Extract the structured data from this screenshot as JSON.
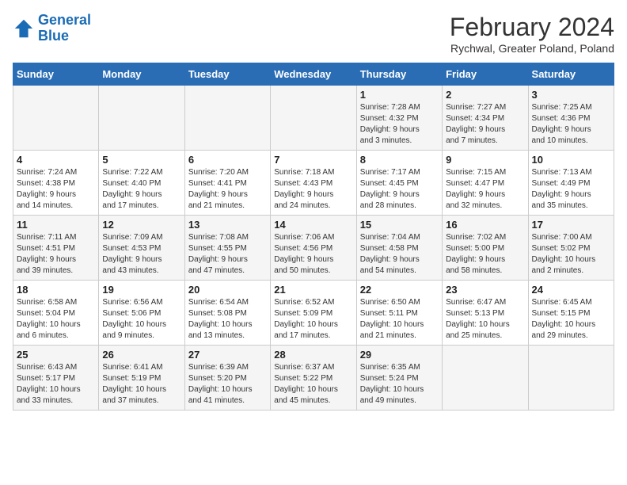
{
  "logo": {
    "line1": "General",
    "line2": "Blue"
  },
  "header": {
    "month": "February 2024",
    "location": "Rychwal, Greater Poland, Poland"
  },
  "weekdays": [
    "Sunday",
    "Monday",
    "Tuesday",
    "Wednesday",
    "Thursday",
    "Friday",
    "Saturday"
  ],
  "weeks": [
    [
      {
        "day": "",
        "info": ""
      },
      {
        "day": "",
        "info": ""
      },
      {
        "day": "",
        "info": ""
      },
      {
        "day": "",
        "info": ""
      },
      {
        "day": "1",
        "info": "Sunrise: 7:28 AM\nSunset: 4:32 PM\nDaylight: 9 hours\nand 3 minutes."
      },
      {
        "day": "2",
        "info": "Sunrise: 7:27 AM\nSunset: 4:34 PM\nDaylight: 9 hours\nand 7 minutes."
      },
      {
        "day": "3",
        "info": "Sunrise: 7:25 AM\nSunset: 4:36 PM\nDaylight: 9 hours\nand 10 minutes."
      }
    ],
    [
      {
        "day": "4",
        "info": "Sunrise: 7:24 AM\nSunset: 4:38 PM\nDaylight: 9 hours\nand 14 minutes."
      },
      {
        "day": "5",
        "info": "Sunrise: 7:22 AM\nSunset: 4:40 PM\nDaylight: 9 hours\nand 17 minutes."
      },
      {
        "day": "6",
        "info": "Sunrise: 7:20 AM\nSunset: 4:41 PM\nDaylight: 9 hours\nand 21 minutes."
      },
      {
        "day": "7",
        "info": "Sunrise: 7:18 AM\nSunset: 4:43 PM\nDaylight: 9 hours\nand 24 minutes."
      },
      {
        "day": "8",
        "info": "Sunrise: 7:17 AM\nSunset: 4:45 PM\nDaylight: 9 hours\nand 28 minutes."
      },
      {
        "day": "9",
        "info": "Sunrise: 7:15 AM\nSunset: 4:47 PM\nDaylight: 9 hours\nand 32 minutes."
      },
      {
        "day": "10",
        "info": "Sunrise: 7:13 AM\nSunset: 4:49 PM\nDaylight: 9 hours\nand 35 minutes."
      }
    ],
    [
      {
        "day": "11",
        "info": "Sunrise: 7:11 AM\nSunset: 4:51 PM\nDaylight: 9 hours\nand 39 minutes."
      },
      {
        "day": "12",
        "info": "Sunrise: 7:09 AM\nSunset: 4:53 PM\nDaylight: 9 hours\nand 43 minutes."
      },
      {
        "day": "13",
        "info": "Sunrise: 7:08 AM\nSunset: 4:55 PM\nDaylight: 9 hours\nand 47 minutes."
      },
      {
        "day": "14",
        "info": "Sunrise: 7:06 AM\nSunset: 4:56 PM\nDaylight: 9 hours\nand 50 minutes."
      },
      {
        "day": "15",
        "info": "Sunrise: 7:04 AM\nSunset: 4:58 PM\nDaylight: 9 hours\nand 54 minutes."
      },
      {
        "day": "16",
        "info": "Sunrise: 7:02 AM\nSunset: 5:00 PM\nDaylight: 9 hours\nand 58 minutes."
      },
      {
        "day": "17",
        "info": "Sunrise: 7:00 AM\nSunset: 5:02 PM\nDaylight: 10 hours\nand 2 minutes."
      }
    ],
    [
      {
        "day": "18",
        "info": "Sunrise: 6:58 AM\nSunset: 5:04 PM\nDaylight: 10 hours\nand 6 minutes."
      },
      {
        "day": "19",
        "info": "Sunrise: 6:56 AM\nSunset: 5:06 PM\nDaylight: 10 hours\nand 9 minutes."
      },
      {
        "day": "20",
        "info": "Sunrise: 6:54 AM\nSunset: 5:08 PM\nDaylight: 10 hours\nand 13 minutes."
      },
      {
        "day": "21",
        "info": "Sunrise: 6:52 AM\nSunset: 5:09 PM\nDaylight: 10 hours\nand 17 minutes."
      },
      {
        "day": "22",
        "info": "Sunrise: 6:50 AM\nSunset: 5:11 PM\nDaylight: 10 hours\nand 21 minutes."
      },
      {
        "day": "23",
        "info": "Sunrise: 6:47 AM\nSunset: 5:13 PM\nDaylight: 10 hours\nand 25 minutes."
      },
      {
        "day": "24",
        "info": "Sunrise: 6:45 AM\nSunset: 5:15 PM\nDaylight: 10 hours\nand 29 minutes."
      }
    ],
    [
      {
        "day": "25",
        "info": "Sunrise: 6:43 AM\nSunset: 5:17 PM\nDaylight: 10 hours\nand 33 minutes."
      },
      {
        "day": "26",
        "info": "Sunrise: 6:41 AM\nSunset: 5:19 PM\nDaylight: 10 hours\nand 37 minutes."
      },
      {
        "day": "27",
        "info": "Sunrise: 6:39 AM\nSunset: 5:20 PM\nDaylight: 10 hours\nand 41 minutes."
      },
      {
        "day": "28",
        "info": "Sunrise: 6:37 AM\nSunset: 5:22 PM\nDaylight: 10 hours\nand 45 minutes."
      },
      {
        "day": "29",
        "info": "Sunrise: 6:35 AM\nSunset: 5:24 PM\nDaylight: 10 hours\nand 49 minutes."
      },
      {
        "day": "",
        "info": ""
      },
      {
        "day": "",
        "info": ""
      }
    ]
  ]
}
